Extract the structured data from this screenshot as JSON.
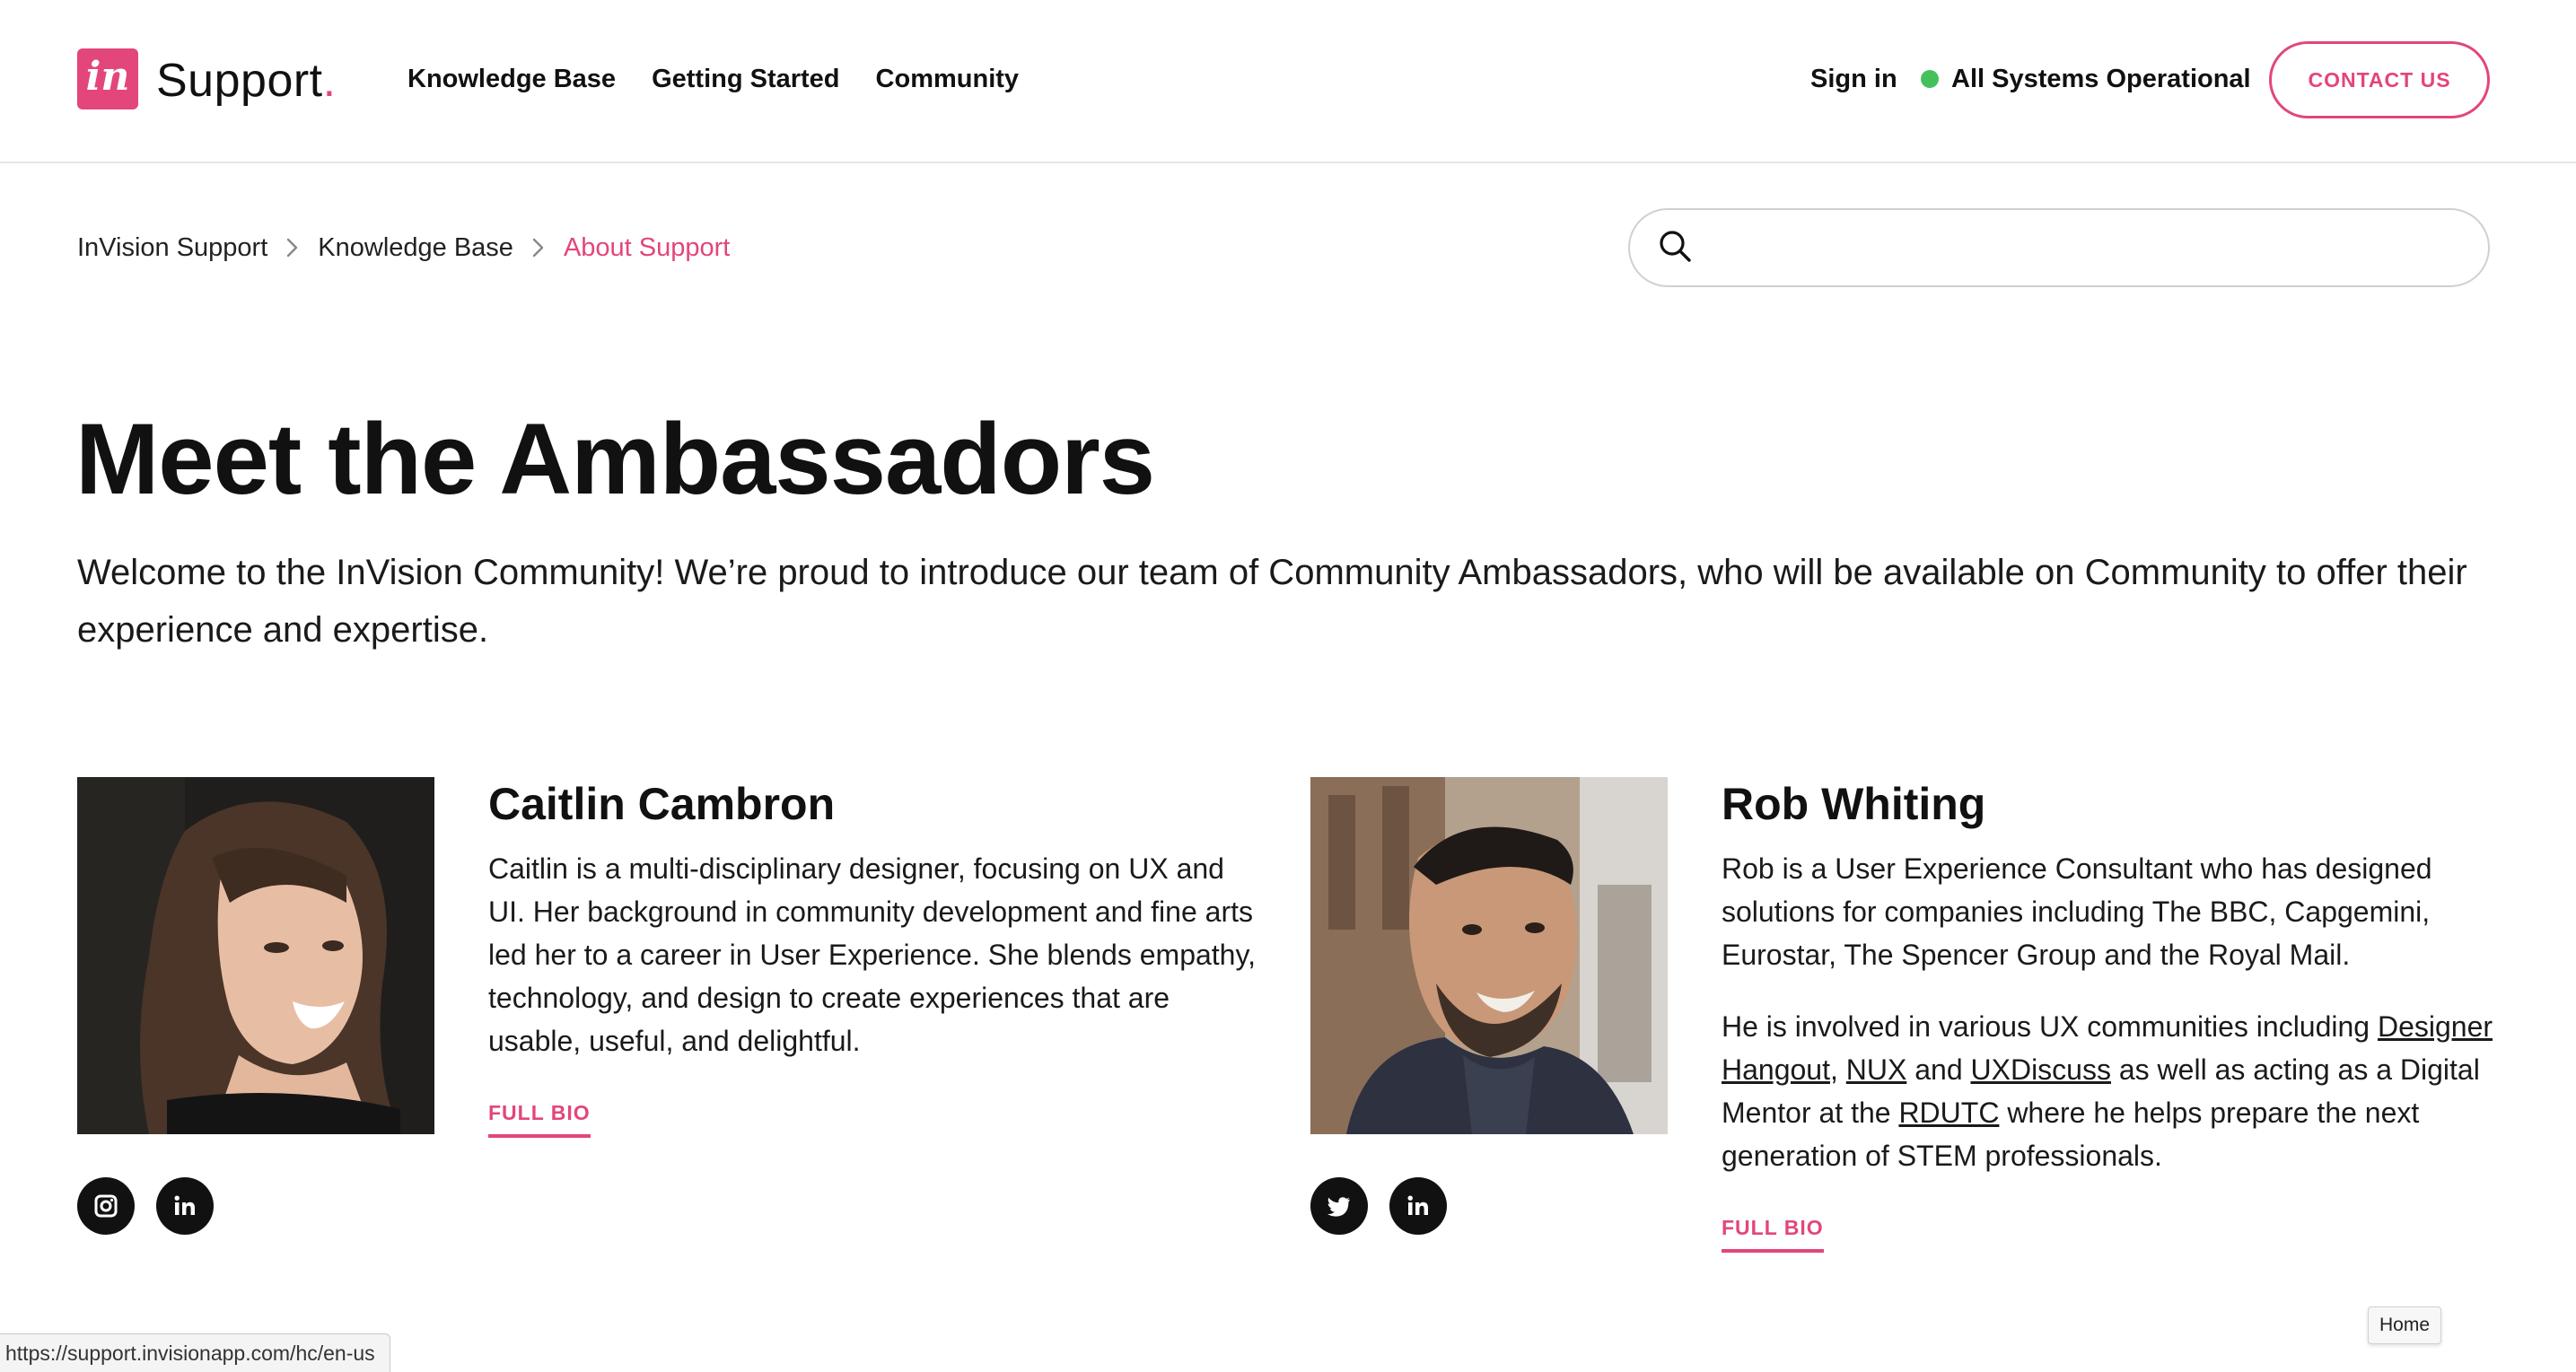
{
  "header": {
    "logo_badge": "in",
    "logo_text": "Support",
    "logo_dot": ".",
    "nav": [
      "Knowledge Base",
      "Getting Started",
      "Community"
    ],
    "sign_in": "Sign in",
    "status": "All Systems Operational",
    "contact": "CONTACT US"
  },
  "breadcrumb": [
    "InVision Support",
    "Knowledge Base",
    "About Support"
  ],
  "search": {
    "placeholder": ""
  },
  "main": {
    "title": "Meet the Ambassadors",
    "intro": "Welcome to the InVision Community! We’re proud to introduce our team of Community Ambassadors, who will be available on Community to offer their experience and expertise."
  },
  "ambassadors": [
    {
      "name": "Caitlin Cambron",
      "bio": "Caitlin is a multi-disciplinary designer, focusing on UX and UI. Her background in community development and fine arts led her to a career in User Experience. She blends empathy, technology, and design to create experiences that are usable, useful, and delightful.",
      "full_bio": "FULL BIO",
      "social": [
        "instagram-icon",
        "linkedin-icon"
      ]
    },
    {
      "name": "Rob Whiting",
      "bio": "Rob is a User Experience Consultant who has designed solutions for companies including The BBC, Capgemini, Eurostar, The Spencer Group and the Royal Mail.",
      "bio2_intro": "He is involved in various UX communities including",
      "links": [
        "Designer Hangout",
        "NUX",
        "UXDiscuss",
        "RDUTC"
      ],
      "bio2_comma": ",",
      "bio2_and": "and",
      "bio2_mid": "as well as acting as a Digital Mentor at the",
      "bio2_end": "where he helps prepare the next generation of STEM professionals.",
      "full_bio": "FULL BIO",
      "social": [
        "twitter-icon",
        "linkedin-icon"
      ]
    }
  ],
  "browser": {
    "status_url": "https://support.invisionapp.com/hc/en-us",
    "tooltip": "Home"
  },
  "colors": {
    "accent": "#e3467a",
    "status_ok": "#45c15c",
    "text": "#111111"
  }
}
